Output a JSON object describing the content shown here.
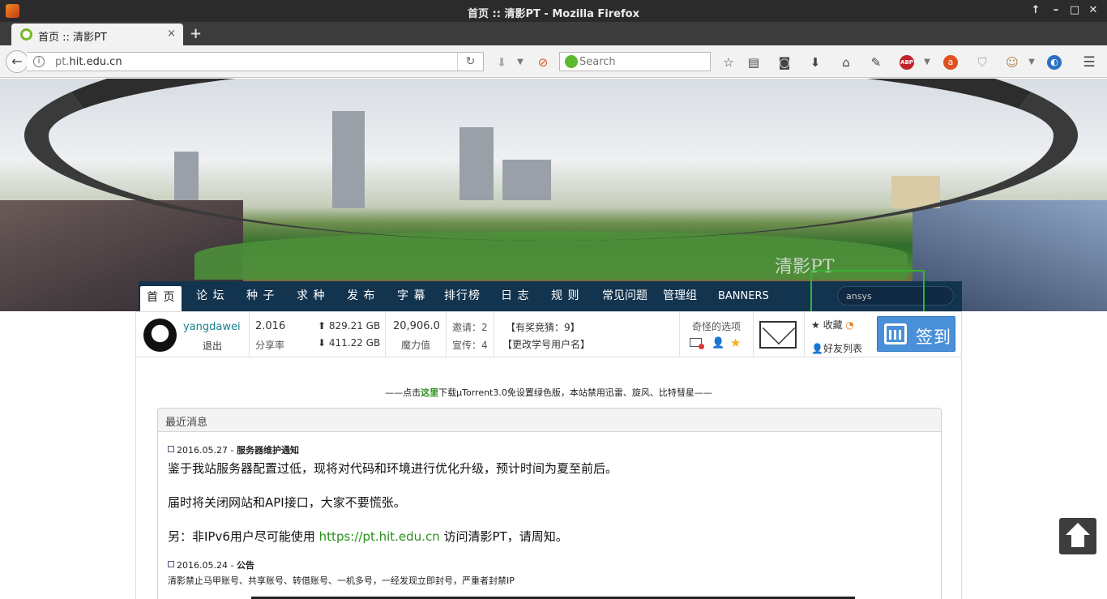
{
  "window": {
    "title": "首页 :: 清影PT - Mozilla Firefox"
  },
  "tab": {
    "label": "首页 :: 清影PT",
    "close": "×",
    "new": "+"
  },
  "navbar": {
    "url_host": "pt.",
    "url_domain": "hit.edu.cn",
    "search_placeholder": "Search",
    "icons": [
      "back-icon",
      "info-icon",
      "reload-icon",
      "download-status-icon",
      "no-icon",
      "search-engine-icon",
      "bookmark-star-icon",
      "reading-list-icon",
      "pocket-icon",
      "downloads-icon",
      "home-icon",
      "share-icon",
      "adblock-plus-icon",
      "addon-a-icon",
      "shield-icon",
      "monkey-icon",
      "globe-icon",
      "menu-icon"
    ]
  },
  "site": {
    "logo_text": "清影PT",
    "nav": [
      "首 页",
      "论 坛",
      "种 子",
      "求 种",
      "发 布",
      "字 幕",
      "排行榜",
      "日 志",
      "规 则",
      "常见问题",
      "管理组",
      "BANNERS"
    ],
    "search_value": "ansys"
  },
  "user": {
    "name": "yangdawei",
    "logout": "退出",
    "share_ratio": "2.016",
    "share_ratio_label": "分享率",
    "uploaded": "829.21 GB",
    "downloaded": "411.22 GB",
    "bonus": "20,906.0",
    "bonus_label": "魔力值",
    "invite": "邀请：2",
    "promo": "宣传：4",
    "quiz": "【有奖竞猜：9】",
    "rename": "【更改学号用户名】",
    "odd_options": "奇怪的选项",
    "favorites": "收藏",
    "friends": "好友列表",
    "checkin": "签到"
  },
  "promo_line": {
    "before": "——点击",
    "link": "这里",
    "after": "下载μTorrent3.0免设置绿色版，本站禁用迅雷、旋风、比特彗星——"
  },
  "news": {
    "heading": "最近消息",
    "items": [
      {
        "date": "2016.05.27 - ",
        "title": "服务器维护通知",
        "lines": [
          "鉴于我站服务器配置过低，现将对代码和环境进行优化升级，预计时间为夏至前后。",
          "届时将关闭网站和API接口，大家不要慌张。"
        ],
        "line3_before": "另：非IPv6用户尽可能使用 ",
        "line3_link": "https://pt.hit.edu.cn",
        "line3_after": " 访问清影PT，请周知。"
      },
      {
        "date": "2016.05.24 - ",
        "title": "公告",
        "small": "清影禁止马甲账号、共享账号、转借账号、一机多号，一经发现立即封号，严重者封禁IP"
      }
    ]
  }
}
